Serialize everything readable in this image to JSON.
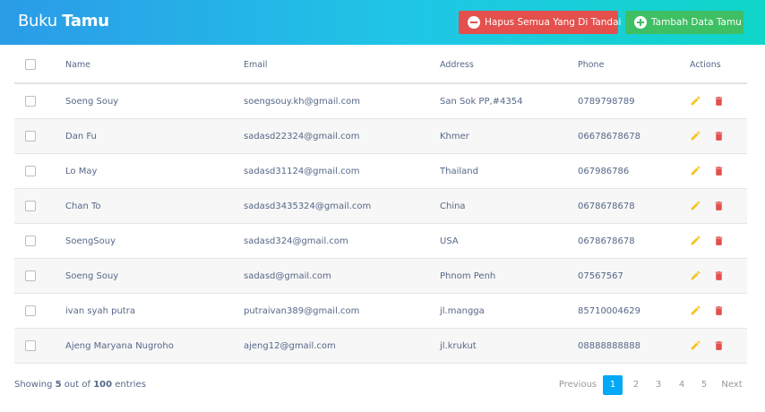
{
  "header": {
    "title_light": "Buku",
    "title_bold": "Tamu",
    "delete_button": "Hapus Semua Yang Di Tandai",
    "add_button": "Tambah Data Tamu"
  },
  "table": {
    "columns": [
      "Name",
      "Email",
      "Address",
      "Phone",
      "Actions"
    ],
    "rows": [
      {
        "name": "Soeng Souy",
        "email": "soengsouy.kh@gmail.com",
        "address": "San Sok PP,#4354",
        "phone": "0789798789"
      },
      {
        "name": "Dan Fu",
        "email": "sadasd22324@gmail.com",
        "address": "Khmer",
        "phone": "06678678678"
      },
      {
        "name": "Lo May",
        "email": "sadasd31124@gmail.com",
        "address": "Thailand",
        "phone": "067986786"
      },
      {
        "name": "Chan To",
        "email": "sadasd3435324@gmail.com",
        "address": "China",
        "phone": "0678678678"
      },
      {
        "name": "SoengSouy",
        "email": "sadasd324@gmail.com",
        "address": "USA",
        "phone": "0678678678"
      },
      {
        "name": "Soeng Souy",
        "email": "sadasd@gmail.com",
        "address": "Phnom Penh",
        "phone": "07567567"
      },
      {
        "name": "ivan syah putra",
        "email": "putraivan389@gmail.com",
        "address": "jl.mangga",
        "phone": "85710004629"
      },
      {
        "name": "Ajeng Maryana Nugroho",
        "email": "ajeng12@gmail.com",
        "address": "jl.krukut",
        "phone": "08888888888"
      }
    ]
  },
  "footer": {
    "showing_prefix": "Showing",
    "showing_count": "5",
    "showing_mid": "out of",
    "showing_total": "100",
    "showing_suffix": "entries"
  },
  "pagination": {
    "previous": "Previous",
    "pages": [
      "1",
      "2",
      "3",
      "4",
      "5"
    ],
    "active_page": "1",
    "next": "Next"
  },
  "colors": {
    "edit_icon": "#f6c423",
    "delete_icon": "#e3504d",
    "active_page": "#03a9f4"
  }
}
